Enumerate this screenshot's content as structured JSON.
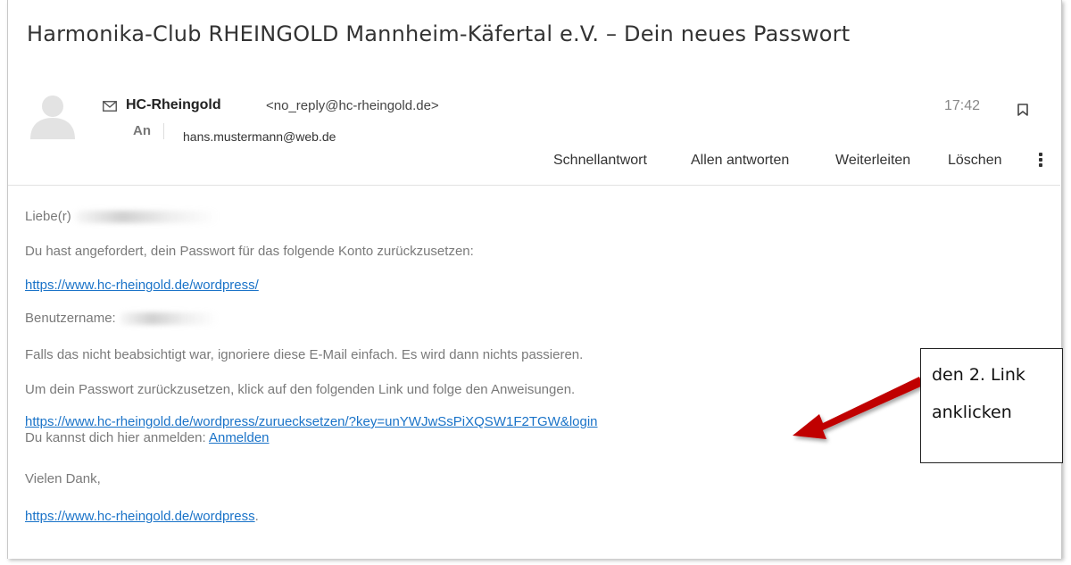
{
  "email": {
    "subject": "Harmonika-Club RHEINGOLD Mannheim-Käfertal e.V. – Dein neues Passwort",
    "sender_name": "HC-Rheingold",
    "sender_address": "<no_reply@hc-rheingold.de>",
    "to_label": "An",
    "recipient": "hans.mustermann@web.de",
    "time": "17:42"
  },
  "actions": {
    "quick_reply": "Schnellantwort",
    "reply_all": "Allen antworten",
    "forward": "Weiterleiten",
    "delete": "Löschen"
  },
  "body": {
    "greeting": "Liebe(r)",
    "line_request": "Du hast angefordert, dein Passwort für das folgende Konto zurückzusetzen:",
    "link_site": "https://www.hc-rheingold.de/wordpress/",
    "username_label": "Benutzername:",
    "line_ignore": "Falls das nicht beabsichtigt war, ignoriere diese E-Mail einfach. Es wird dann nichts passieren.",
    "line_instructions": "Um dein Passwort zurückzusetzen, klick auf den folgenden Link und folge den Anweisungen.",
    "link_reset": "https://www.hc-rheingold.de/wordpress/zuruecksetzen/?key=unYWJwSsPiXQSW1F2TGW&login",
    "login_text": "Du kannst dich hier anmelden:",
    "login_link": "Anmelden",
    "thanks": "Vielen Dank,",
    "link_footer": "https://www.hc-rheingold.de/wordpress",
    "footer_period": "."
  },
  "callout": {
    "line1": "den 2. Link",
    "line2": "anklicken",
    "arrow_color": "#c00000"
  },
  "colors": {
    "link": "#1a73c8",
    "body_text": "#7a7a7a"
  }
}
